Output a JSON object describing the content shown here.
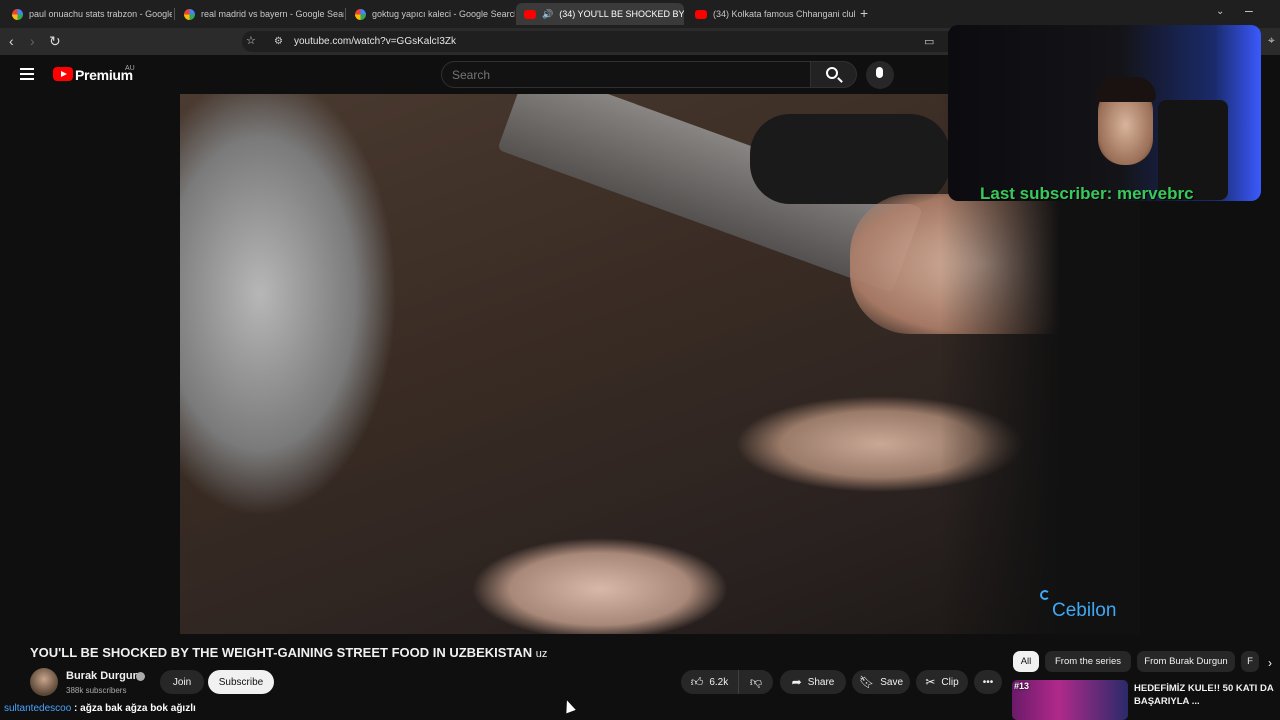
{
  "browser": {
    "tabs": [
      {
        "title": "paul onuachu stats trabzon - Google",
        "favicon": "google-icon"
      },
      {
        "title": "real madrid vs bayern - Google Sear",
        "favicon": "google-icon"
      },
      {
        "title": "goktug yapıcı kaleci - Google Search",
        "favicon": "google-icon"
      },
      {
        "title": "(34) YOU'LL BE SHOCKED BY",
        "favicon": "youtube-icon",
        "active": true
      },
      {
        "title": "(34) Kolkata famous Chhangani club",
        "favicon": "youtube-icon"
      }
    ],
    "url": "youtube.com/watch?v=GGsKalcI3Zk"
  },
  "youtube": {
    "logo_text": "Premium",
    "region": "AU",
    "search_placeholder": "Search"
  },
  "stream_overlay": {
    "webcam_caption": "Last subscriber: mervebrc",
    "watermark": "Cebilon"
  },
  "video": {
    "title": "YOU'LL BE SHOCKED BY THE WEIGHT-GAINING STREET FOOD IN UZBEKISTAN",
    "channel": "Burak Durgun",
    "subscribers": "388k subscribers",
    "join_label": "Join",
    "subscribe_label": "Subscribe",
    "likes": "6.2k",
    "share_label": "Share",
    "save_label": "Save",
    "clip_label": "Clip",
    "more_label": "•••"
  },
  "chips": [
    "All",
    "From the series",
    "From Burak Durgun",
    "F"
  ],
  "recommendation": {
    "rank": "#13",
    "title": "HEDEFİMİZ KULE!! 50 KATI DA BAŞARIYLA ..."
  },
  "chat": {
    "user": "sultantedescoo",
    "message": " : ağza bak ağza bok ağızlı"
  },
  "colors": {
    "background": "#0f0f0f",
    "brand_red": "#ff0000",
    "overlay_green": "#38c95a",
    "chat_user": "#4aa3ff",
    "watermark_blue": "#3fa9f5"
  }
}
